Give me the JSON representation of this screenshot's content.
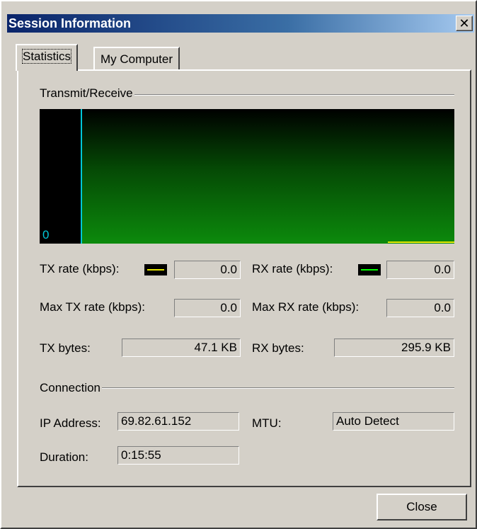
{
  "window": {
    "title": "Session Information",
    "close_glyph": "✕"
  },
  "tabs": [
    {
      "label": "Statistics",
      "active": true
    },
    {
      "label": "My Computer",
      "active": false
    }
  ],
  "transmit_receive": {
    "group_label": "Transmit/Receive",
    "graph_zero_label": "0",
    "tx_color": "#e6e600",
    "rx_color": "#00ff00",
    "graph_fill_color": "#0c8a0c"
  },
  "stats": {
    "tx_rate_label": "TX rate (kbps):",
    "tx_rate_value": "0.0",
    "rx_rate_label": "RX rate (kbps):",
    "rx_rate_value": "0.0",
    "max_tx_label": "Max TX rate (kbps):",
    "max_tx_value": "0.0",
    "max_rx_label": "Max RX rate (kbps):",
    "max_rx_value": "0.0",
    "tx_bytes_label": "TX bytes:",
    "tx_bytes_value": "47.1 KB",
    "rx_bytes_label": "RX bytes:",
    "rx_bytes_value": "295.9 KB"
  },
  "connection": {
    "group_label": "Connection",
    "ip_label": "IP Address:",
    "ip_value": "69.82.61.152",
    "mtu_label": "MTU:",
    "mtu_value": "Auto Detect",
    "duration_label": "Duration:",
    "duration_value": "0:15:55"
  },
  "buttons": {
    "close_label": "Close"
  }
}
